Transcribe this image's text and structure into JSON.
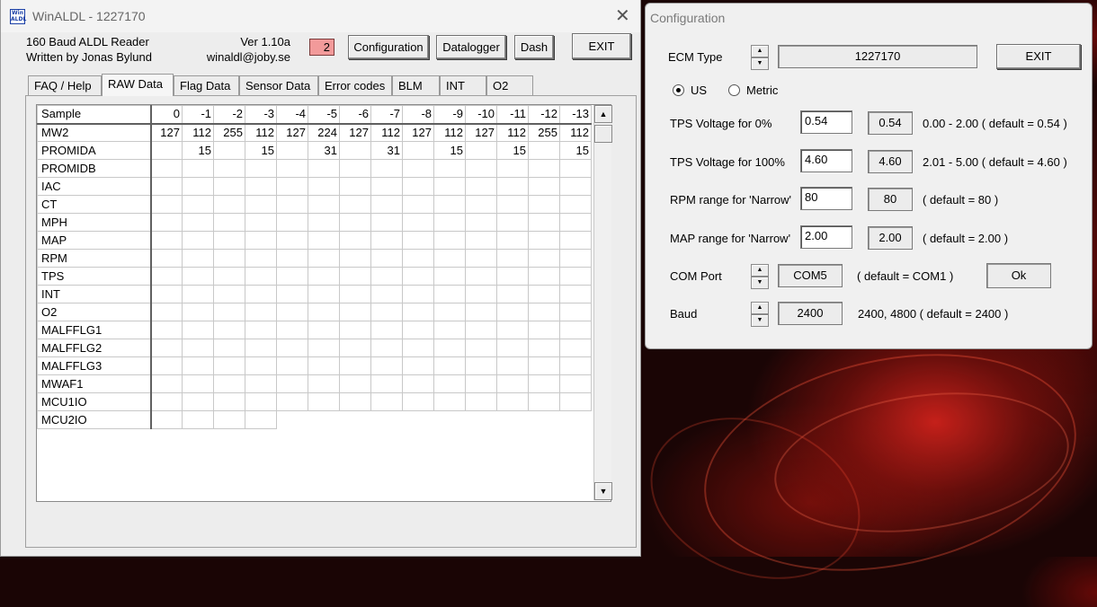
{
  "main_window": {
    "title": "WinALDL - 1227170",
    "icon_text": "Win ALDL",
    "info": {
      "line1": "160 Baud ALDL Reader",
      "line2": "Written by Jonas Bylund",
      "version": "Ver 1.10a",
      "email": "winaldl@joby.se"
    },
    "indicator_value": "2",
    "buttons": {
      "configuration": "Configuration",
      "datalogger": "Datalogger",
      "dash": "Dash",
      "exit": "EXIT"
    },
    "tabs": [
      "FAQ / Help",
      "RAW Data",
      "Flag Data",
      "Sensor Data",
      "Error codes",
      "BLM",
      "INT",
      "O2"
    ],
    "active_tab": "RAW Data",
    "grid": {
      "corner": "Sample",
      "columns": [
        "0",
        "-1",
        "-2",
        "-3",
        "-4",
        "-5",
        "-6",
        "-7",
        "-8",
        "-9",
        "-10",
        "-11",
        "-12",
        "-13"
      ],
      "rows": [
        {
          "name": "MW2",
          "values": [
            "127",
            "112",
            "255",
            "112",
            "127",
            "224",
            "127",
            "112",
            "127",
            "112",
            "127",
            "112",
            "255",
            "112"
          ]
        },
        {
          "name": "PROMIDA",
          "values": [
            "",
            "15",
            "",
            "15",
            "",
            "31",
            "",
            "31",
            "",
            "15",
            "",
            "15",
            "",
            "15"
          ]
        },
        {
          "name": "PROMIDB",
          "values": []
        },
        {
          "name": "IAC",
          "values": []
        },
        {
          "name": "CT",
          "values": []
        },
        {
          "name": "MPH",
          "values": []
        },
        {
          "name": "MAP",
          "values": []
        },
        {
          "name": "RPM",
          "values": []
        },
        {
          "name": "TPS",
          "values": []
        },
        {
          "name": "INT",
          "values": []
        },
        {
          "name": "O2",
          "values": []
        },
        {
          "name": "MALFFLG1",
          "values": []
        },
        {
          "name": "MALFFLG2",
          "values": []
        },
        {
          "name": "MALFFLG3",
          "values": []
        },
        {
          "name": "MWAF1",
          "values": []
        },
        {
          "name": "MCU1IO",
          "values": []
        },
        {
          "name": "MCU2IO",
          "values": []
        }
      ]
    },
    "close_glyph": "✕"
  },
  "config_window": {
    "title": "Configuration",
    "ecm": {
      "label": "ECM Type",
      "value": "1227170"
    },
    "exit_label": "EXIT",
    "units": {
      "us": "US",
      "metric": "Metric",
      "selected": "US"
    },
    "tps0": {
      "label": "TPS Voltage for 0%",
      "input": "0.54",
      "current": "0.54",
      "hint": "0.00 - 2.00 ( default = 0.54 )"
    },
    "tps100": {
      "label": "TPS Voltage for 100%",
      "input": "4.60",
      "current": "4.60",
      "hint": "2.01 - 5.00 ( default = 4.60 )"
    },
    "rpm_range": {
      "label": "RPM range for 'Narrow'",
      "input": "80",
      "current": "80",
      "hint": "( default = 80 )"
    },
    "map_range": {
      "label": "MAP range for 'Narrow'",
      "input": "2.00",
      "current": "2.00",
      "hint": "( default = 2.00 )"
    },
    "com_port": {
      "label": "COM Port",
      "value": "COM5",
      "hint": "( default = COM1 )",
      "status": "Ok"
    },
    "baud": {
      "label": "Baud",
      "value": "2400",
      "hint": "2400, 4800  ( default = 2400 )"
    }
  },
  "icons": [
    "app-icon",
    "close-icon",
    "scroll-up-icon",
    "scroll-down-icon",
    "spin-up-icon",
    "spin-down-icon"
  ],
  "colors": {
    "indicator": "#f29a9a",
    "window": "#ededed",
    "desktop": "#1a0505"
  }
}
